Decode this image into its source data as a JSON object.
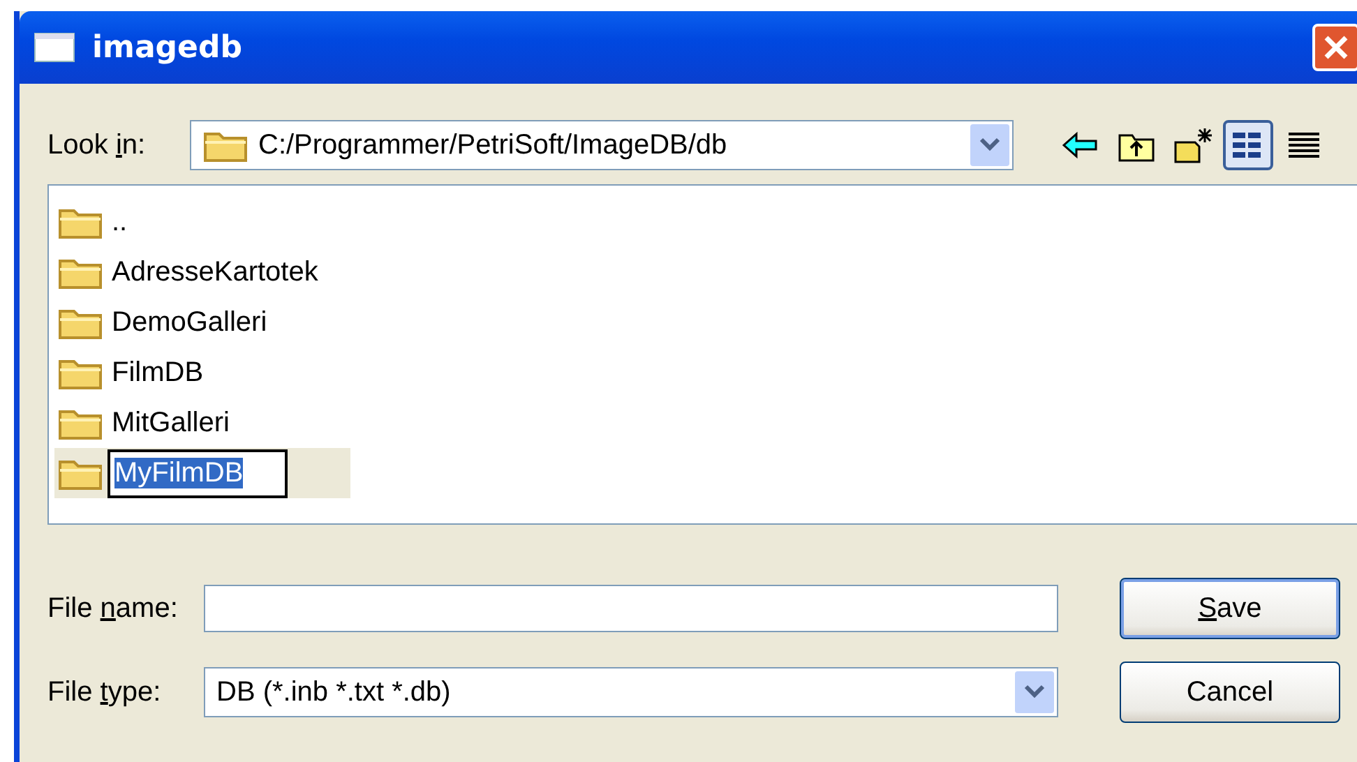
{
  "window": {
    "title": "imagedb"
  },
  "look_in": {
    "label_parts": [
      {
        "text": "Look ",
        "underline": false
      },
      {
        "text": "i",
        "underline": true
      },
      {
        "text": "n:",
        "underline": false
      }
    ],
    "value": "C:/Programmer/PetriSoft/ImageDB/db"
  },
  "toolbar": [
    {
      "kind": "back",
      "selected": false
    },
    {
      "kind": "up",
      "selected": false
    },
    {
      "kind": "new-folder",
      "selected": false
    },
    {
      "kind": "list-view",
      "selected": true
    },
    {
      "kind": "detail-view",
      "selected": false
    }
  ],
  "files": [
    {
      "name": "..",
      "selected": false,
      "editing": false
    },
    {
      "name": "AdresseKartotek",
      "selected": false,
      "editing": false
    },
    {
      "name": "DemoGalleri",
      "selected": false,
      "editing": false
    },
    {
      "name": "FilmDB",
      "selected": false,
      "editing": false
    },
    {
      "name": "MitGalleri",
      "selected": false,
      "editing": false
    },
    {
      "name": "MyFilmDB",
      "selected": true,
      "editing": true
    }
  ],
  "file_name": {
    "label_parts": [
      {
        "text": "File ",
        "underline": false
      },
      {
        "text": "n",
        "underline": true
      },
      {
        "text": "ame:",
        "underline": false
      }
    ]
  },
  "file_type": {
    "label_parts": [
      {
        "text": "File ",
        "underline": false
      },
      {
        "text": "t",
        "underline": true
      },
      {
        "text": "ype:",
        "underline": false
      }
    ],
    "value": "DB (*.inb *.txt *.db)"
  },
  "buttons": [
    {
      "label_parts": [
        {
          "text": "S",
          "underline": true
        },
        {
          "text": "ave",
          "underline": false
        }
      ],
      "default": true
    },
    {
      "label_parts": [
        {
          "text": "Cancel",
          "underline": false
        }
      ],
      "default": false
    }
  ]
}
